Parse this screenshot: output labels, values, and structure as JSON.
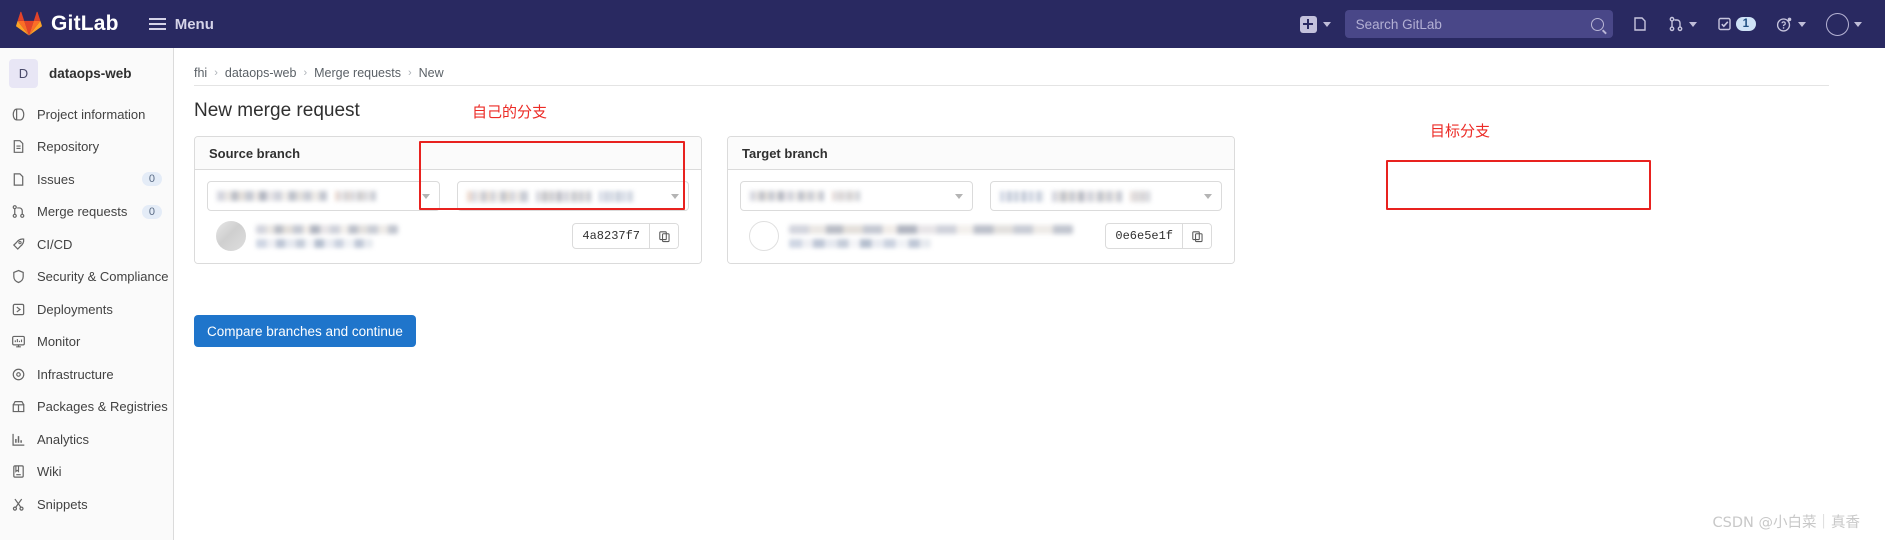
{
  "topbar": {
    "brand": "GitLab",
    "menu_label": "Menu",
    "logo_icon": "gitlab-tanuki-logo",
    "hamburger_icon": "hamburger-menu-icon",
    "create_new_icon": "plus-square-icon",
    "create_new_chevron_icon": "chevron-down-icon",
    "search_placeholder": "Search GitLab",
    "search_value": "",
    "search_icon": "search-icon",
    "issues_icon": "issues-icon",
    "merge_requests_icon": "merge-request-icon",
    "merge_requests_chevron_icon": "chevron-down-icon",
    "todos_icon": "todo-checkbox-icon",
    "todos_count": "1",
    "help_icon": "question-circle-icon",
    "help_chevron_icon": "chevron-down-icon",
    "avatar_icon": "user-avatar",
    "avatar_chevron_icon": "chevron-down-icon",
    "bg_color": "#292961"
  },
  "sidebar": {
    "project_initial": "D",
    "project_name": "dataops-web",
    "items": [
      {
        "label": "Project information",
        "icon": "information-icon",
        "badge": ""
      },
      {
        "label": "Repository",
        "icon": "document-icon",
        "badge": ""
      },
      {
        "label": "Issues",
        "icon": "issues-icon",
        "badge": "0"
      },
      {
        "label": "Merge requests",
        "icon": "merge-request-icon",
        "badge": "0"
      },
      {
        "label": "CI/CD",
        "icon": "rocket-icon",
        "badge": ""
      },
      {
        "label": "Security & Compliance",
        "icon": "shield-icon",
        "badge": ""
      },
      {
        "label": "Deployments",
        "icon": "deployments-icon",
        "badge": ""
      },
      {
        "label": "Monitor",
        "icon": "monitor-icon",
        "badge": ""
      },
      {
        "label": "Infrastructure",
        "icon": "cloud-gear-icon",
        "badge": ""
      },
      {
        "label": "Packages & Registries",
        "icon": "package-icon",
        "badge": ""
      },
      {
        "label": "Analytics",
        "icon": "chart-bar-icon",
        "badge": ""
      },
      {
        "label": "Wiki",
        "icon": "book-icon",
        "badge": ""
      },
      {
        "label": "Snippets",
        "icon": "scissors-icon",
        "badge": ""
      }
    ]
  },
  "breadcrumb": {
    "items": [
      "fhi",
      "dataops-web",
      "Merge requests",
      "New"
    ],
    "separator": "›"
  },
  "main": {
    "page_title": "New merge request",
    "compare_button": "Compare branches and continue",
    "source_panel": {
      "title": "Source branch",
      "project_select_value": "",
      "branch_select_value": "",
      "chevron_icon": "chevron-down-icon",
      "commit_sha": "4a8237f7",
      "copy_icon": "copy-to-clipboard-icon",
      "avatar_icon": "user-avatar",
      "commit_title": "",
      "commit_meta": ""
    },
    "target_panel": {
      "title": "Target branch",
      "project_select_value": "",
      "branch_select_value": "",
      "chevron_icon": "chevron-down-icon",
      "commit_sha": "0e6e5e1f",
      "copy_icon": "copy-to-clipboard-icon",
      "avatar_icon": "user-avatar",
      "commit_title": "",
      "commit_meta": ""
    }
  },
  "annotations": {
    "color": "#ec2b26",
    "source_label": "自己的分支",
    "target_label": "目标分支"
  },
  "watermark": "CSDN @小白菜｜真香"
}
